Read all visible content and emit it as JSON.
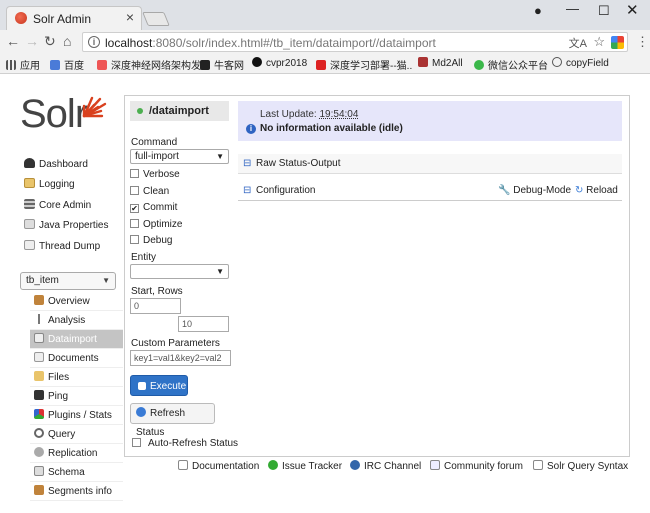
{
  "browser": {
    "tab_title": "Solr Admin",
    "tab_close": "×",
    "url_host": "localhost",
    "url_rest": ":8080/solr/index.html#/tb_item/dataimport//dataimport",
    "bookmarks": [
      "应用",
      "百度",
      "深度神经网络架构发",
      "牛客网",
      "cvpr2018",
      "深度学习部署--猫..",
      "Md2All",
      "微信公众平台",
      "copyField"
    ]
  },
  "logo": {
    "text": "Solr"
  },
  "sidebar": {
    "items": [
      "Dashboard",
      "Logging",
      "Core Admin",
      "Java Properties",
      "Thread Dump"
    ],
    "core_selected": "tb_item",
    "core_items": [
      "Overview",
      "Analysis",
      "Dataimport",
      "Documents",
      "Files",
      "Ping",
      "Plugins / Stats",
      "Query",
      "Replication",
      "Schema",
      "Segments info"
    ]
  },
  "left_panel": {
    "title": "/dataimport",
    "command_label": "Command",
    "command_value": "full-import",
    "checkboxes": [
      {
        "label": "Verbose",
        "checked": false
      },
      {
        "label": "Clean",
        "checked": false
      },
      {
        "label": "Commit",
        "checked": true
      },
      {
        "label": "Optimize",
        "checked": false
      },
      {
        "label": "Debug",
        "checked": false
      }
    ],
    "entity_label": "Entity",
    "entity_value": "",
    "start_rows_label": "Start, Rows",
    "start_value": "0",
    "rows_value": "10",
    "custom_params_label": "Custom Parameters",
    "custom_params_value": "key1=val1&key2=val2",
    "execute_label": "Execute",
    "refresh_label": "Refresh Status",
    "auto_refresh_label": "Auto-Refresh Status"
  },
  "status": {
    "last_update_label": "Last Update:",
    "last_update_time": "19:54:04",
    "message": "No information available (idle)"
  },
  "sections": {
    "raw_status": "Raw Status-Output",
    "configuration": "Configuration",
    "debug_mode": "Debug-Mode",
    "reload": "Reload"
  },
  "footer": [
    "Documentation",
    "Issue Tracker",
    "IRC Channel",
    "Community forum",
    "Solr Query Syntax"
  ]
}
